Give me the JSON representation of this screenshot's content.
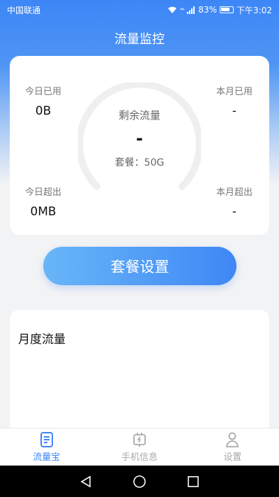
{
  "status_bar": {
    "carrier": "中国联通",
    "network": "⁴⁶",
    "battery": "83%",
    "time": "下午3:02"
  },
  "page_title": "流量监控",
  "stats": {
    "today_used": {
      "label": "今日已用",
      "value": "0B"
    },
    "month_used": {
      "label": "本月已用",
      "value": "-"
    },
    "today_over": {
      "label": "今日超出",
      "value": "0MB"
    },
    "month_over": {
      "label": "本月超出",
      "value": "-"
    }
  },
  "gauge": {
    "label": "剩余流量",
    "value": "-",
    "plan_label": "套餐：50G"
  },
  "plan_button": "套餐设置",
  "monthly": {
    "title": "月度流量"
  },
  "tabs": [
    {
      "label": "流量宝",
      "icon": "document-icon",
      "active": true
    },
    {
      "label": "手机信息",
      "icon": "charger-icon",
      "active": false
    },
    {
      "label": "设置",
      "icon": "user-icon",
      "active": false
    }
  ],
  "colors": {
    "accent": "#3d86f6",
    "gradient_start": "#68b6f8",
    "gradient_end": "#3f87f5"
  }
}
